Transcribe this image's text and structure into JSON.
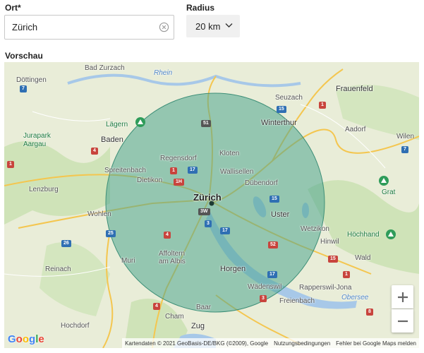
{
  "form": {
    "ort_label": "Ort*",
    "ort_value": "Zürich",
    "radius_label": "Radius",
    "radius_value": "20 km",
    "preview_label": "Vorschau"
  },
  "map": {
    "places": {
      "bad_zurzach": "Bad Zurzach",
      "dottingen": "Döttingen",
      "rhein": "Rhein",
      "seuzach": "Seuzach",
      "frauenfeld": "Frauenfeld",
      "lagern": "Lägern",
      "winterthur": "Winterthur",
      "jurapark": "Jurapark",
      "aargau": "Aargau",
      "baden": "Baden",
      "aadorf": "Aadorf",
      "wilen": "Wilen",
      "regensdorf": "Regensdorf",
      "kloten": "Kloten",
      "spreitenbach": "Spreitenbach",
      "wallisellen": "Wallisellen",
      "dietikon": "Dietikon",
      "dubendorf": "Dübendorf",
      "grat": "Grat",
      "lenzburg": "Lenzburg",
      "zurich": "Zürich",
      "wohlen": "Wohlen",
      "uster": "Uster",
      "wetzikon": "Wetzikon",
      "hochhand": "Höchhand",
      "hinwil": "Hinwil",
      "affoltern_1": "Affoltern",
      "affoltern_2": "am Albis",
      "wald": "Wald",
      "muri": "Muri",
      "reinach": "Reinach",
      "horgen": "Horgen",
      "rapperswil": "Rapperswil-Jona",
      "wadenswil": "Wädenswil",
      "obersee": "Obersee",
      "freienbach": "Freienbach",
      "baar": "Baar",
      "hochdorf": "Hochdorf",
      "cham": "Cham",
      "zug": "Zug"
    },
    "shields": {
      "s7": "7",
      "s51": "51",
      "s15a": "15",
      "s1a": "1",
      "s7b": "7",
      "s4a": "4",
      "s1b": "1",
      "s17a": "17",
      "s1h": "1H",
      "s1c": "1",
      "s15b": "15",
      "s3w": "3W",
      "s3a": "3",
      "s17b": "17",
      "s4b": "4",
      "s52": "52",
      "s15c": "15",
      "s25": "25",
      "s26": "26",
      "s17c": "17",
      "s3b": "3",
      "s4c": "4",
      "s8": "8",
      "s1d": "1"
    },
    "zoom_in": "+",
    "zoom_out": "−",
    "google": [
      "G",
      "o",
      "o",
      "g",
      "l",
      "e"
    ],
    "attribution": {
      "data": "Kartendaten © 2021 GeoBasis-DE/BKG (©2009), Google",
      "terms": "Nutzungsbedingungen",
      "report": "Fehler bei Google Maps melden"
    },
    "circle_color": "#4fa68f",
    "lake_color": "#a7c8e8"
  }
}
